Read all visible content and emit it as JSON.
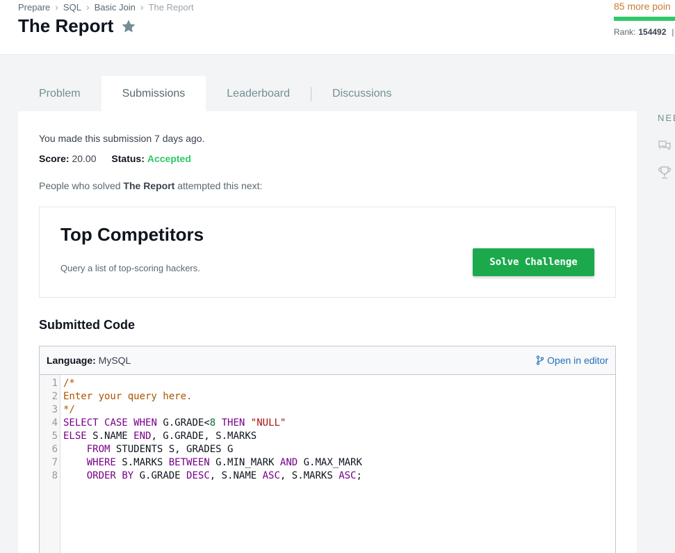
{
  "breadcrumb": {
    "items": [
      "Prepare",
      "SQL",
      "Basic Join"
    ],
    "current": "The Report"
  },
  "page": {
    "title": "The Report"
  },
  "profile": {
    "points_text": "85 more poin",
    "rank_label": "Rank:",
    "rank_value": "154492",
    "rank_divider": "|"
  },
  "tabs": [
    {
      "label": "Problem",
      "active": false
    },
    {
      "label": "Submissions",
      "active": true
    },
    {
      "label": "Leaderboard",
      "active": false
    },
    {
      "label": "Discussions",
      "active": false
    }
  ],
  "submission": {
    "info": "You made this submission 7 days ago.",
    "score_label": "Score:",
    "score_value": "20.00",
    "status_label": "Status:",
    "status_value": "Accepted",
    "next_prefix": "People who solved",
    "next_challenge_name": "The Report",
    "next_suffix": "attempted this next:"
  },
  "next_challenge": {
    "title": "Top Competitors",
    "description": "Query a list of top-scoring hackers.",
    "button_label": "Solve Challenge"
  },
  "code": {
    "heading": "Submitted Code",
    "language_label": "Language:",
    "language_value": "MySQL",
    "open_editor_label": "Open in editor",
    "line_numbers": [
      "1",
      "2",
      "3",
      "4",
      "5",
      "6",
      "7",
      "8"
    ],
    "lines": [
      "/*",
      "Enter your query here.",
      "*/",
      "SELECT CASE WHEN G.GRADE<8 THEN \"NULL\"",
      "ELSE S.NAME END, G.GRADE, S.MARKS",
      "    FROM STUDENTS S, GRADES G",
      "    WHERE S.MARKS BETWEEN G.MIN_MARK AND G.MAX_MARK",
      "    ORDER BY G.GRADE DESC, S.NAME ASC, S.MARKS ASC;"
    ]
  },
  "sidebar": {
    "heading": "NEE"
  },
  "colors": {
    "accent_green": "#1ba94c",
    "status_green": "#2ec866",
    "link_blue": "#1f70b8",
    "points_orange": "#c77b33"
  }
}
